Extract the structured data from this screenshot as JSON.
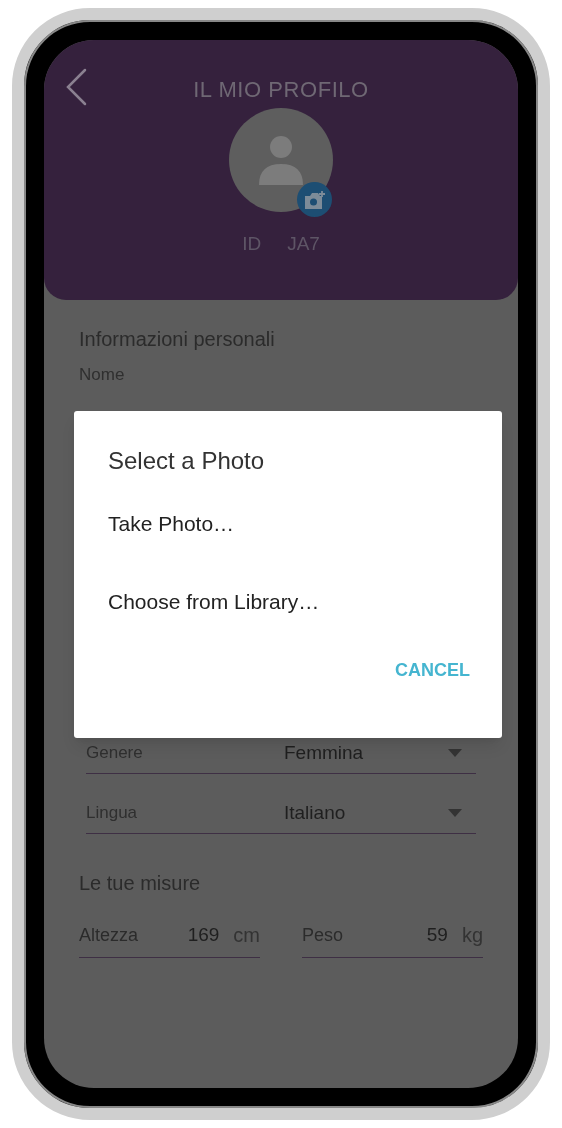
{
  "header": {
    "title": "IL MIO PROFILO",
    "id_label": "ID",
    "id_value": "JA7"
  },
  "personal": {
    "title": "Informazioni personali",
    "name_placeholder": "Nome",
    "fields": [
      {
        "label": "Genere",
        "value": "Femmina"
      },
      {
        "label": "Lingua",
        "value": "Italiano"
      }
    ]
  },
  "measures": {
    "title": "Le tue misure",
    "items": [
      {
        "label": "Altezza",
        "value": "169",
        "unit": "cm"
      },
      {
        "label": "Peso",
        "value": "59",
        "unit": "kg"
      }
    ]
  },
  "dialog": {
    "title": "Select a Photo",
    "options": [
      "Take Photo…",
      "Choose from Library…"
    ],
    "cancel": "CANCEL"
  }
}
